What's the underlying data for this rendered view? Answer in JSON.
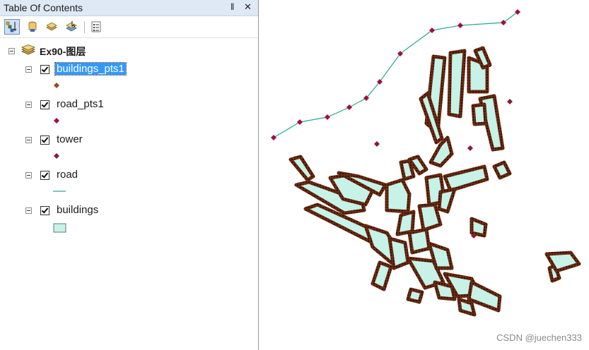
{
  "toc": {
    "title": "Table Of Contents",
    "pin_glyph": "‖",
    "close_glyph": "✕",
    "toolbar": [
      {
        "name": "list-by-drawing-order-icon",
        "active": true
      },
      {
        "name": "list-by-source-icon",
        "active": false
      },
      {
        "name": "list-by-visibility-icon",
        "active": false
      },
      {
        "name": "list-by-selection-icon",
        "active": false
      },
      {
        "name": "options-icon",
        "active": false
      }
    ],
    "group": {
      "label": "Ex90-图层",
      "icon": "layers-icon"
    },
    "layers": [
      {
        "label": "buildings_pts1",
        "checked": true,
        "selected": true,
        "symbol": "point",
        "color": "#9b4a1c"
      },
      {
        "label": "road_pts1",
        "checked": true,
        "selected": false,
        "symbol": "point",
        "color": "#a0103a"
      },
      {
        "label": "tower",
        "checked": true,
        "selected": false,
        "symbol": "point",
        "color": "#8b1a3a"
      },
      {
        "label": "road",
        "checked": true,
        "selected": false,
        "symbol": "line",
        "color": "#2aa98a"
      },
      {
        "label": "buildings",
        "checked": true,
        "selected": false,
        "symbol": "polygon",
        "color": "#c6f2e8"
      }
    ]
  },
  "map": {
    "watermark": "CSDN @juechen333",
    "colors": {
      "building_fill": "#c6f2e8",
      "building_outline": "#6b2a10",
      "road": "#2aa98a",
      "road_point": "#a0103a",
      "tower": "#8b1a3a"
    }
  }
}
